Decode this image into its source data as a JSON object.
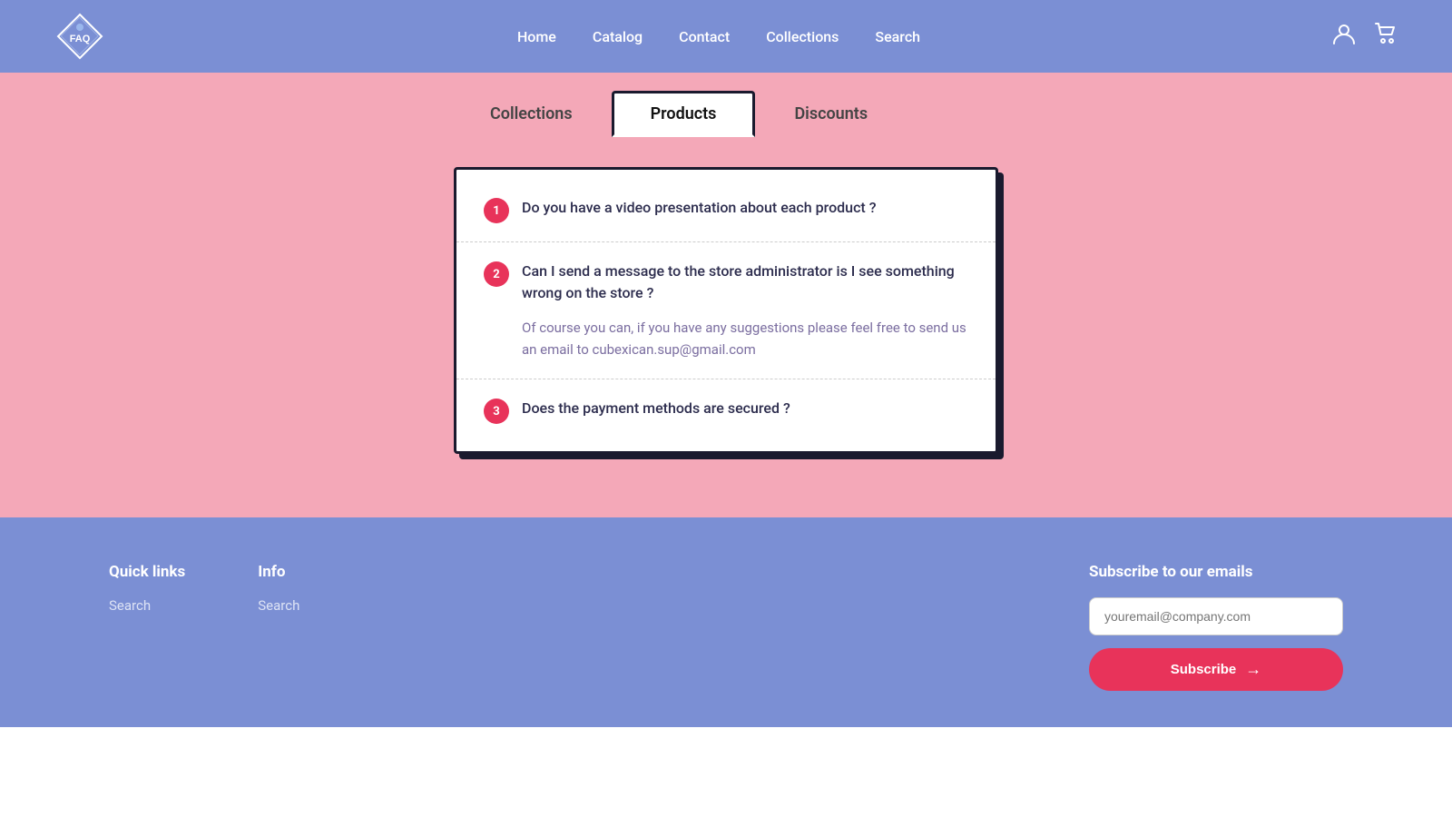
{
  "header": {
    "logo_text": "FAQ",
    "nav": {
      "items": [
        {
          "label": "Home",
          "id": "home"
        },
        {
          "label": "Catalog",
          "id": "catalog"
        },
        {
          "label": "Contact",
          "id": "contact"
        },
        {
          "label": "Collections",
          "id": "collections"
        },
        {
          "label": "Search",
          "id": "search"
        }
      ]
    }
  },
  "tabs": [
    {
      "label": "Collections",
      "id": "collections",
      "active": false
    },
    {
      "label": "Products",
      "id": "products",
      "active": true
    },
    {
      "label": "Discounts",
      "id": "discounts",
      "active": false
    }
  ],
  "faq": {
    "items": [
      {
        "number": "1",
        "question": "Do you have a video presentation about each product ?",
        "answer": null
      },
      {
        "number": "2",
        "question": "Can I send a message to the store administrator is I see something wrong on the store ?",
        "answer": "Of course you can, if you have any suggestions please feel free to send us an email to cubexican.sup@gmail.com"
      },
      {
        "number": "3",
        "question": "Does the payment methods are secured ?",
        "answer": null
      }
    ]
  },
  "footer": {
    "quick_links": {
      "heading": "Quick links",
      "items": [
        {
          "label": "Search"
        }
      ]
    },
    "info": {
      "heading": "Info",
      "items": [
        {
          "label": "Search"
        }
      ]
    },
    "subscribe": {
      "heading": "Subscribe to our emails",
      "email_placeholder": "youremail@company.com",
      "button_label": "Subscribe"
    }
  }
}
